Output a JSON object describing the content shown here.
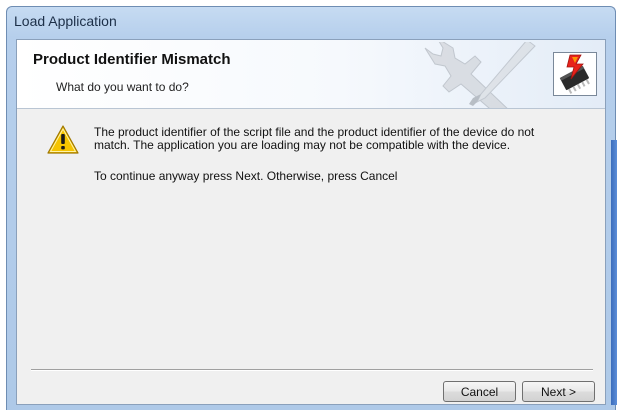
{
  "window": {
    "title": "Load Application"
  },
  "header": {
    "title": "Product Identifier Mismatch",
    "subtitle": "What do you want to do?"
  },
  "message": {
    "line1": "The product identifier of the script file and the product identifier of the device do not",
    "line2": "match.  The application you are loading may not be compatible with the device.",
    "instruction": "To continue anyway press Next.  Otherwise, press Cancel"
  },
  "buttons": {
    "cancel": "Cancel",
    "next": "Next >"
  },
  "icons": {
    "warning": "warning-triangle-icon",
    "chip": "chip-lightning-icon",
    "tools": "wrench-screwdriver-icon"
  },
  "colors": {
    "title_bar": "#b6cfec",
    "client_bg": "#f0f0f0",
    "warning": "#f5c400",
    "lightning": "#e8221b"
  }
}
